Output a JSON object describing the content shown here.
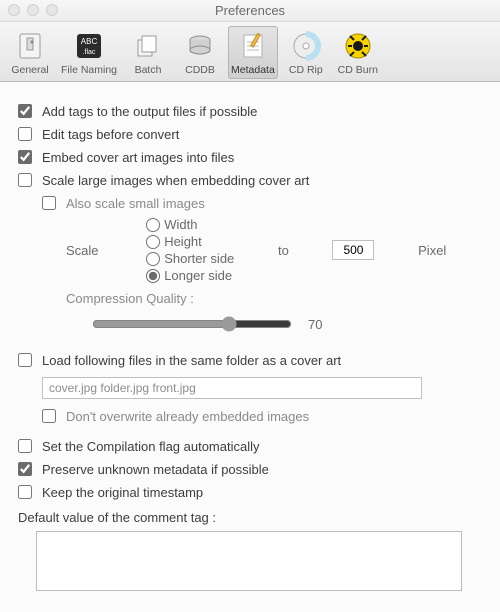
{
  "window": {
    "title": "Preferences"
  },
  "toolbar": {
    "items": [
      {
        "label": "General"
      },
      {
        "label": "File Naming"
      },
      {
        "label": "Batch"
      },
      {
        "label": "CDDB"
      },
      {
        "label": "Metadata"
      },
      {
        "label": "CD Rip"
      },
      {
        "label": "CD Burn"
      }
    ],
    "selected": "Metadata"
  },
  "opts": {
    "addTags": {
      "label": "Add tags to the output files if possible",
      "checked": true
    },
    "editBefore": {
      "label": "Edit tags before convert",
      "checked": false
    },
    "embedCover": {
      "label": "Embed cover art images into files",
      "checked": true
    },
    "scaleLarge": {
      "label": "Scale large images when embedding cover art",
      "checked": false
    },
    "alsoSmall": {
      "label": "Also scale small images",
      "checked": false
    },
    "scaleLabel": "Scale",
    "toLabel": "to",
    "pixelLabel": "Pixel",
    "scaleValue": "500",
    "radios": {
      "width": "Width",
      "height": "Height",
      "shorter": "Shorter side",
      "longer": "Longer side",
      "selected": "longer"
    },
    "compressionLabel": "Compression Quality :",
    "compressionValue": "70",
    "loadFollowing": {
      "label": "Load following files in the same folder as a cover art",
      "checked": false
    },
    "coverFiles": "cover.jpg folder.jpg front.jpg",
    "dontOverwrite": {
      "label": "Don't overwrite already embedded images",
      "checked": false
    },
    "setCompilation": {
      "label": "Set the Compilation flag automatically",
      "checked": false
    },
    "preserveUnknown": {
      "label": "Preserve unknown metadata if possible",
      "checked": true
    },
    "keepTimestamp": {
      "label": "Keep the original timestamp",
      "checked": false
    },
    "commentLabel": "Default value of the comment tag :",
    "commentValue": ""
  }
}
